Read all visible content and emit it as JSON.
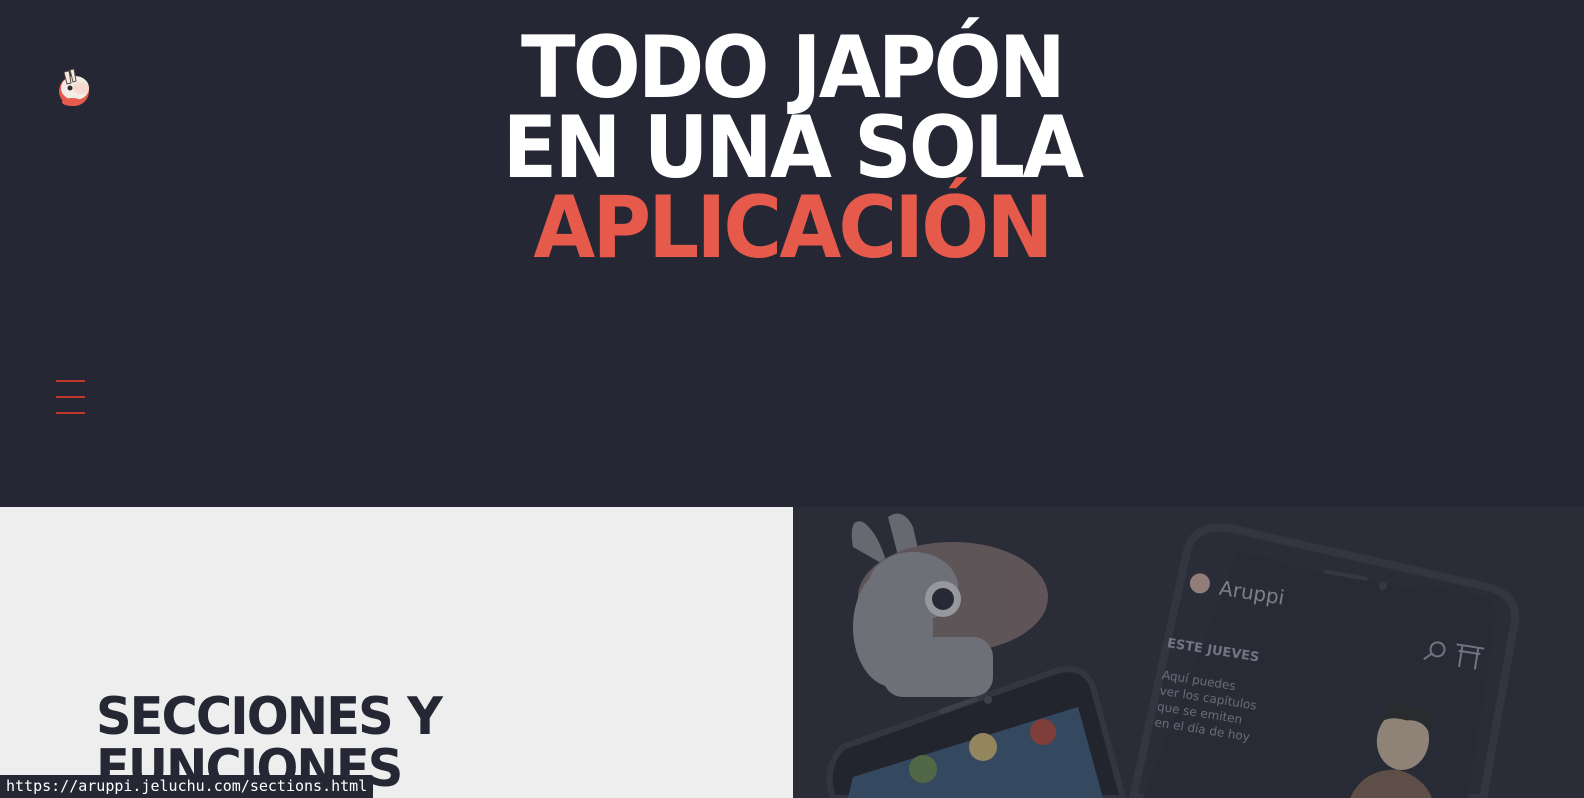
{
  "hero": {
    "line1": "TODO JAPÓN",
    "line2": "EN UNA SOLA",
    "line3": "APLICACIÓN"
  },
  "sections": {
    "title_line1": "SECCIONES Y",
    "title_line2": "FUNCIONES"
  },
  "phone": {
    "app_name": "Aruppi",
    "day_heading": "ESTE JUEVES",
    "caption_line1": "Aquí puedes",
    "caption_line2": "ver los capítulos",
    "caption_line3": "que se emiten",
    "caption_line4": "en el día de hoy"
  },
  "status_bar": {
    "url": "https://aruppi.jeluchu.com/sections.html"
  },
  "colors": {
    "background": "#252834",
    "accent": "#e65a4c",
    "menu_icon": "#c0392b",
    "panel_light": "#eeeeee"
  },
  "icons": {
    "logo": "llama-logo-icon",
    "menu": "hamburger-menu-icon",
    "search": "search-icon",
    "torii": "torii-gate-icon"
  }
}
